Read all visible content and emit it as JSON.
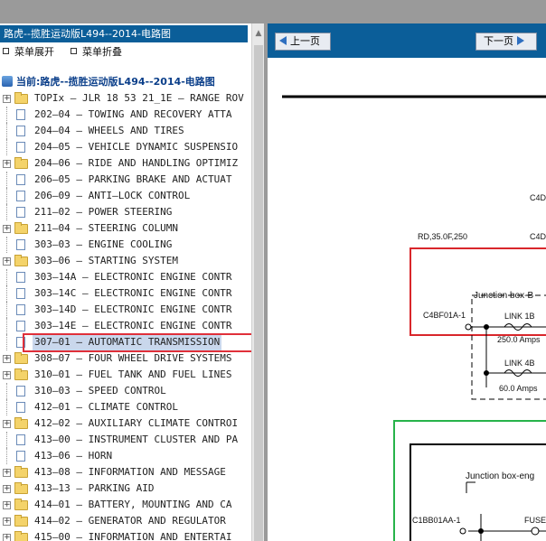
{
  "left_pane": {
    "title": "路虎--揽胜运动版L494--2014-电路图",
    "expand_all": "菜单展开",
    "collapse_all": "菜单折叠",
    "root_label": "当前:路虎--揽胜运动版L494--2014-电路图",
    "items": [
      {
        "label": "TOPIx — JLR 18 53 21_1E — RANGE ROV",
        "type": "folder"
      },
      {
        "label": "202—04 — TOWING AND RECOVERY ATTA",
        "type": "doc"
      },
      {
        "label": "204—04 — WHEELS AND TIRES",
        "type": "doc"
      },
      {
        "label": "204—05 — VEHICLE DYNAMIC SUSPENSIO",
        "type": "doc"
      },
      {
        "label": "204—06 — RIDE AND HANDLING OPTIMIZ",
        "type": "folder"
      },
      {
        "label": "206—05 — PARKING BRAKE AND ACTUAT",
        "type": "doc"
      },
      {
        "label": "206—09 — ANTI—LOCK CONTROL",
        "type": "doc"
      },
      {
        "label": "211—02 — POWER STEERING",
        "type": "doc"
      },
      {
        "label": "211—04 — STEERING COLUMN",
        "type": "folder"
      },
      {
        "label": "303—03 — ENGINE COOLING",
        "type": "doc"
      },
      {
        "label": "303—06 — STARTING SYSTEM",
        "type": "folder"
      },
      {
        "label": "303—14A — ELECTRONIC ENGINE CONTR",
        "type": "doc"
      },
      {
        "label": "303—14C — ELECTRONIC ENGINE CONTR",
        "type": "doc"
      },
      {
        "label": "303—14D — ELECTRONIC ENGINE CONTR",
        "type": "doc"
      },
      {
        "label": "303—14E — ELECTRONIC ENGINE CONTR",
        "type": "doc"
      },
      {
        "label": "307—01 — AUTOMATIC TRANSMISSION",
        "type": "doc",
        "selected": true
      },
      {
        "label": "308—07 — FOUR WHEEL DRIVE SYSTEMS",
        "type": "folder"
      },
      {
        "label": "310—01 — FUEL TANK AND FUEL LINES",
        "type": "folder"
      },
      {
        "label": "310—03 — SPEED CONTROL",
        "type": "doc"
      },
      {
        "label": "412—01 — CLIMATE CONTROL",
        "type": "doc"
      },
      {
        "label": "412—02 — AUXILIARY CLIMATE CONTROI",
        "type": "folder"
      },
      {
        "label": "413—00 — INSTRUMENT CLUSTER AND PA",
        "type": "doc"
      },
      {
        "label": "413—06 — HORN",
        "type": "doc"
      },
      {
        "label": "413—08 — INFORMATION AND MESSAGE",
        "type": "folder"
      },
      {
        "label": "413—13 — PARKING AID",
        "type": "folder"
      },
      {
        "label": "414—01 — BATTERY, MOUNTING AND CA",
        "type": "folder"
      },
      {
        "label": "414—02 — GENERATOR AND REGULATOR",
        "type": "folder"
      },
      {
        "label": "415—00 — INFORMATION AND ENTERTAI",
        "type": "folder"
      }
    ]
  },
  "right_pane": {
    "prev_label": "上一页",
    "next_label": "下一页",
    "diagram": {
      "labels": {
        "c4d_1": "C4D",
        "c4d_2": "C4D",
        "wire": "RD,35.0F,250",
        "junction_1": "Junction box-B",
        "connector_1": "C4BF01A-1",
        "link_1b": "LINK 1B",
        "amps_250": "250.0 Amps",
        "link_4b": "LINK 4B",
        "amps_60": "60.0 Amps",
        "junction_2": "Junction box-eng",
        "connector_2": "C1BB01AA-1",
        "fuse": "FUSE"
      },
      "colors": {
        "red_box": "#d9262b",
        "green_box": "#27b34a"
      }
    }
  }
}
